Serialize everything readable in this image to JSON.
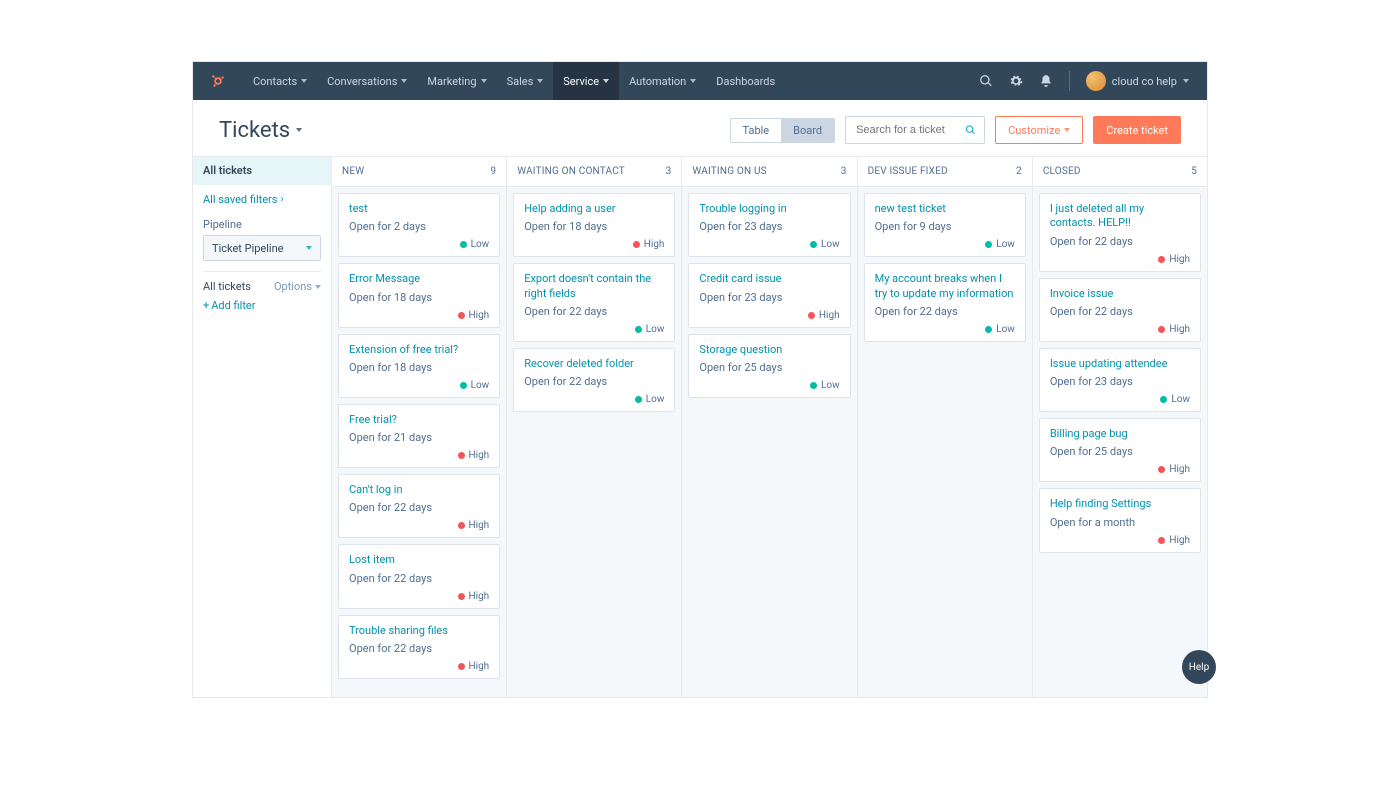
{
  "nav": {
    "items": [
      "Contacts",
      "Conversations",
      "Marketing",
      "Sales",
      "Service",
      "Automation",
      "Dashboards"
    ],
    "activeIndex": 4,
    "account": "cloud co help"
  },
  "toolbar": {
    "title": "Tickets",
    "viewTable": "Table",
    "viewBoard": "Board",
    "searchPlaceholder": "Search for a ticket",
    "customize": "Customize",
    "create": "Create ticket"
  },
  "sidebar": {
    "allTickets": "All tickets",
    "savedFilters": "All saved filters",
    "pipelineLabel": "Pipeline",
    "pipelineValue": "Ticket Pipeline",
    "filtersTitle": "All tickets",
    "options": "Options",
    "addFilter": "Add filter"
  },
  "columns": [
    {
      "name": "NEW",
      "count": 9,
      "cards": [
        {
          "title": "test",
          "sub": "Open for 2 days",
          "prio": "Low"
        },
        {
          "title": "Error Message",
          "sub": "Open for 18 days",
          "prio": "High"
        },
        {
          "title": "Extension of free trial?",
          "sub": "Open for 18 days",
          "prio": "Low"
        },
        {
          "title": "Free trial?",
          "sub": "Open for 21 days",
          "prio": "High"
        },
        {
          "title": "Can't log in",
          "sub": "Open for 22 days",
          "prio": "High"
        },
        {
          "title": "Lost item",
          "sub": "Open for 22 days",
          "prio": "High"
        },
        {
          "title": "Trouble sharing files",
          "sub": "Open for 22 days",
          "prio": "High"
        }
      ]
    },
    {
      "name": "WAITING ON CONTACT",
      "count": 3,
      "cards": [
        {
          "title": "Help adding a user",
          "sub": "Open for 18 days",
          "prio": "High"
        },
        {
          "title": "Export doesn't contain the right fields",
          "sub": "Open for 22 days",
          "prio": "Low"
        },
        {
          "title": "Recover deleted folder",
          "sub": "Open for 22 days",
          "prio": "Low"
        }
      ]
    },
    {
      "name": "WAITING ON US",
      "count": 3,
      "cards": [
        {
          "title": "Trouble logging in",
          "sub": "Open for 23 days",
          "prio": "Low"
        },
        {
          "title": "Credit card issue",
          "sub": "Open for 23 days",
          "prio": "High"
        },
        {
          "title": "Storage question",
          "sub": "Open for 25 days",
          "prio": "Low"
        }
      ]
    },
    {
      "name": "DEV ISSUE FIXED",
      "count": 2,
      "cards": [
        {
          "title": "new test ticket",
          "sub": "Open for 9 days",
          "prio": "Low"
        },
        {
          "title": "My account breaks when I try to update my information",
          "sub": "Open for 22 days",
          "prio": "Low"
        }
      ]
    },
    {
      "name": "CLOSED",
      "count": 5,
      "cards": [
        {
          "title": "I just deleted all my contacts. HELP!!",
          "sub": "Open for 22 days",
          "prio": "High"
        },
        {
          "title": "Invoice issue",
          "sub": "Open for 22 days",
          "prio": "High"
        },
        {
          "title": "Issue updating attendee",
          "sub": "Open for 23 days",
          "prio": "Low"
        },
        {
          "title": "Billing page bug",
          "sub": "Open for 25 days",
          "prio": "High"
        },
        {
          "title": "Help finding Settings",
          "sub": "Open for a month",
          "prio": "High"
        }
      ]
    }
  ],
  "help": "Help"
}
